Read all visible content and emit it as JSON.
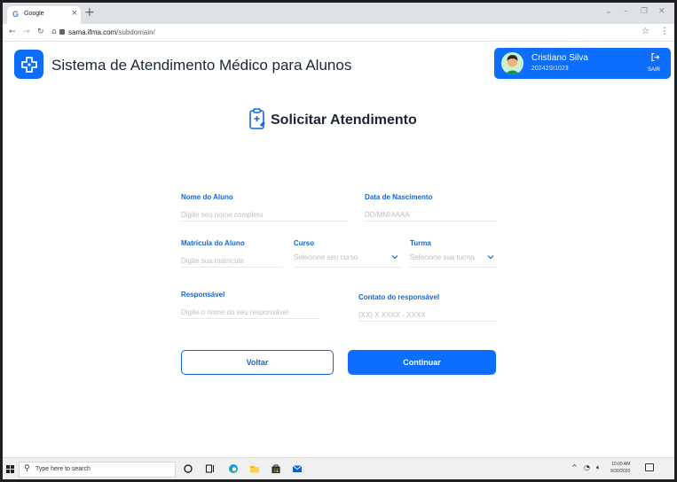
{
  "browser": {
    "tab_favicon": "G",
    "tab_title": "Google",
    "tab_close": "×",
    "new_tab": "+",
    "url_host": "sama.ifma.com",
    "url_path": "/subdomain/",
    "window_controls": [
      "⌄",
      "–",
      "❐",
      "✕"
    ],
    "nav_icons": [
      "back-arrow-icon",
      "forward-arrow-icon",
      "reload-icon",
      "home-icon"
    ]
  },
  "app": {
    "title": "Sistema de Atendimento Médico para Alunos",
    "brand_color": "#0d6efd"
  },
  "user": {
    "name": "Cristiano Silva",
    "id": "20242SI1023",
    "logout_label": "SAIR"
  },
  "page": {
    "title": "Solicitar Atendimento"
  },
  "form": {
    "nome": {
      "label": "Nome do Aluno",
      "placeholder": "Digite seu nome completo"
    },
    "nascimento": {
      "label": "Data de Nascimento",
      "placeholder": "DD/MM/AAAA"
    },
    "matricula": {
      "label": "Matrícula do Aluno",
      "placeholder": "Digite sua matrícula"
    },
    "curso": {
      "label": "Curso",
      "value": "Selecione seu curso"
    },
    "turma": {
      "label": "Turma",
      "value": "Selecione sua turma"
    },
    "responsavel": {
      "label": "Responsável",
      "placeholder": "Digite o nome do seu responsável"
    },
    "contato": {
      "label": "Contato do responsável",
      "placeholder": "(XX) X XXXX - XXXX"
    },
    "back_label": "Voltar",
    "continue_label": "Continuar"
  },
  "taskbar": {
    "search_placeholder": "Type here to search",
    "time": "10:00 AM",
    "date": "9/30/2020"
  }
}
